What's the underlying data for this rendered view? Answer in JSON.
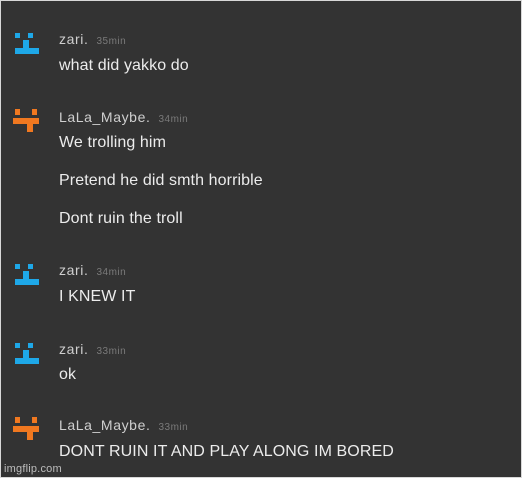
{
  "colors": {
    "background": "#333333",
    "zari_avatar": "#1ea8e8",
    "lala_avatar": "#f07820",
    "username": "#cfcfcf",
    "timestamp": "#7a7a7a",
    "message": "#ececec"
  },
  "messages": [
    {
      "user": "zari.",
      "time": "35min",
      "avatar": "zari-avatar-icon",
      "lines": [
        "what did yakko do"
      ]
    },
    {
      "user": "LaLa_Maybe.",
      "time": "34min",
      "avatar": "lala-avatar-icon",
      "lines": [
        "We trolling him",
        "Pretend he did smth horrible",
        "Dont ruin the troll"
      ]
    },
    {
      "user": "zari.",
      "time": "34min",
      "avatar": "zari-avatar-icon",
      "lines": [
        "I KNEW IT"
      ]
    },
    {
      "user": "zari.",
      "time": "33min",
      "avatar": "zari-avatar-icon",
      "lines": [
        "ok"
      ]
    },
    {
      "user": "LaLa_Maybe.",
      "time": "33min",
      "avatar": "lala-avatar-icon",
      "lines": [
        "DONT RUIN IT AND PLAY ALONG IM BORED"
      ]
    }
  ],
  "watermark": "imgflip.com"
}
